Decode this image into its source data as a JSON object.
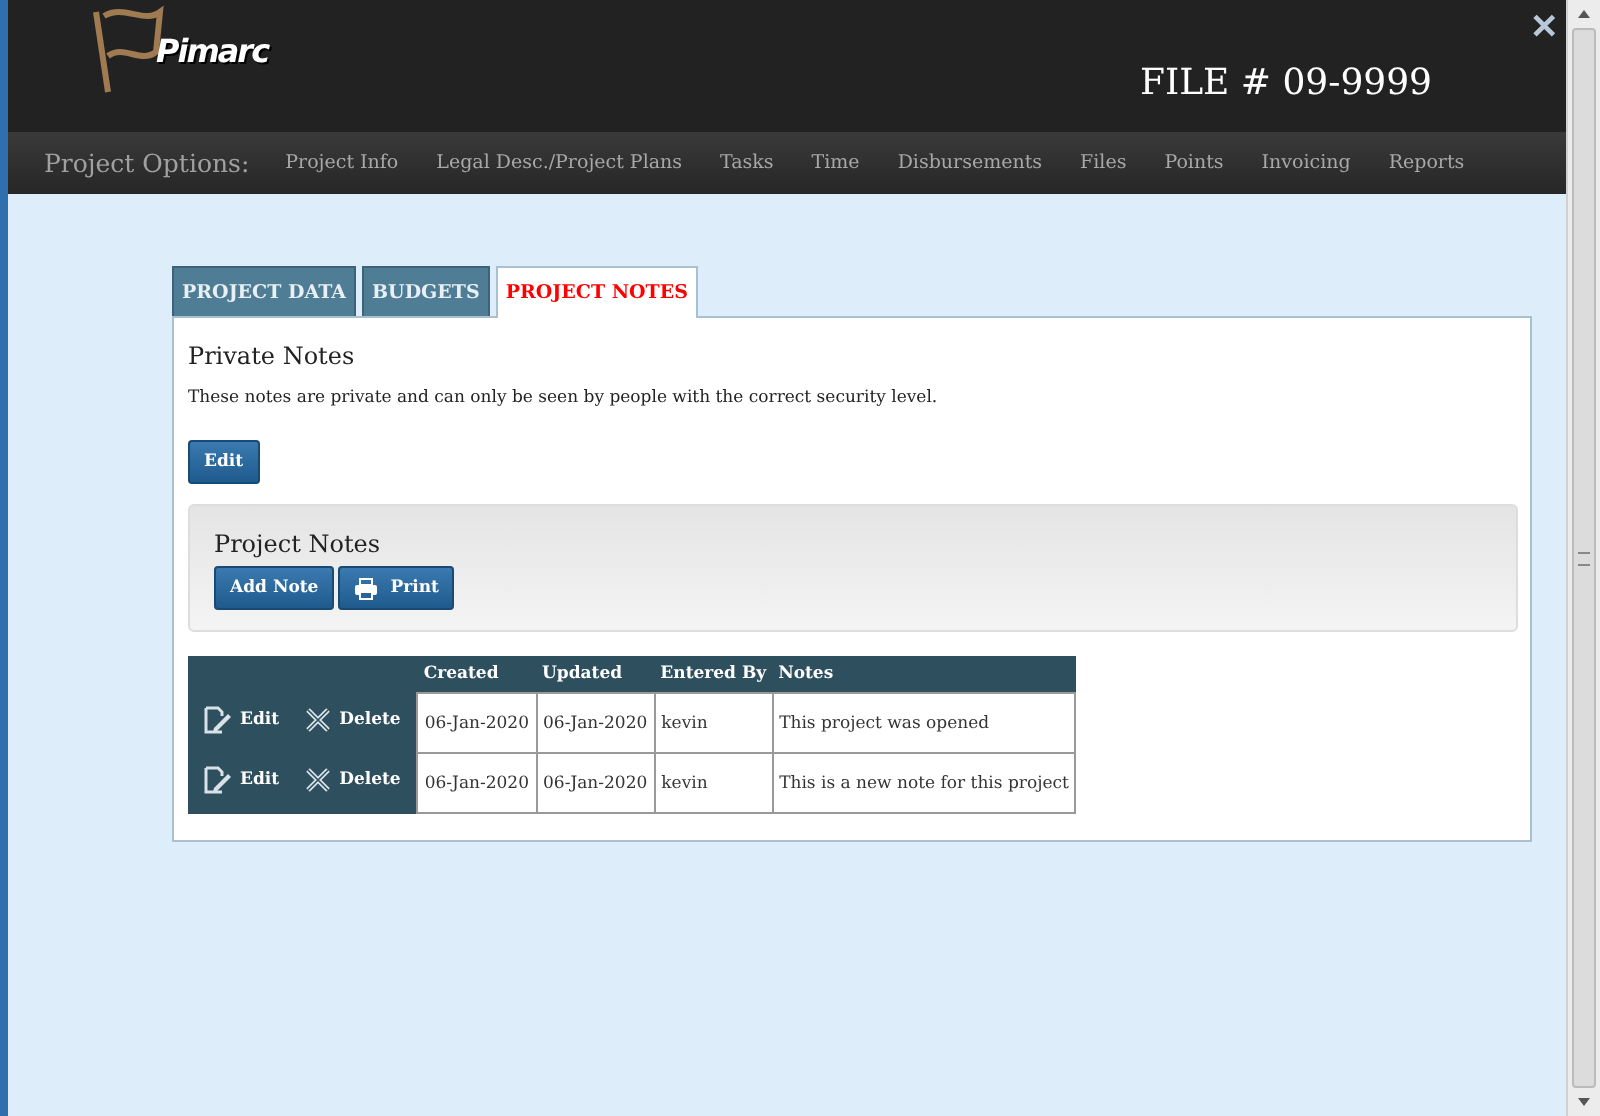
{
  "header": {
    "logo": "Pimarc",
    "file_number": "FILE # 09-9999",
    "close": "✕"
  },
  "nav": {
    "label": "Project Options:",
    "items": [
      "Project Info",
      "Legal Desc./Project Plans",
      "Tasks",
      "Time",
      "Disbursements",
      "Files",
      "Points",
      "Invoicing",
      "Reports"
    ]
  },
  "tabs": [
    {
      "label": "PROJECT DATA",
      "selected": false
    },
    {
      "label": "BUDGETS",
      "selected": false
    },
    {
      "label": "PROJECT NOTES",
      "selected": true
    }
  ],
  "private_notes": {
    "title": "Private Notes",
    "description": "These notes are private and can only be seen by people with the correct security level.",
    "button": "Edit"
  },
  "project_notes": {
    "title": "Project Notes",
    "buttons": [
      {
        "kind": "plain",
        "label": "Add Note"
      },
      {
        "kind": "print",
        "label": "Print"
      }
    ]
  },
  "table": {
    "columns": [
      "Created",
      "Updated",
      "Entered By",
      "Notes"
    ],
    "rows": [
      {
        "edit": "Edit",
        "delete": "Delete",
        "cells": [
          "06-Jan-2020",
          "06-Jan-2020",
          "kevin",
          "This project was opened"
        ]
      },
      {
        "edit": "Edit",
        "delete": "Delete",
        "cells": [
          "06-Jan-2020",
          "06-Jan-2020",
          "kevin",
          "This is a new note for this project"
        ]
      }
    ]
  }
}
